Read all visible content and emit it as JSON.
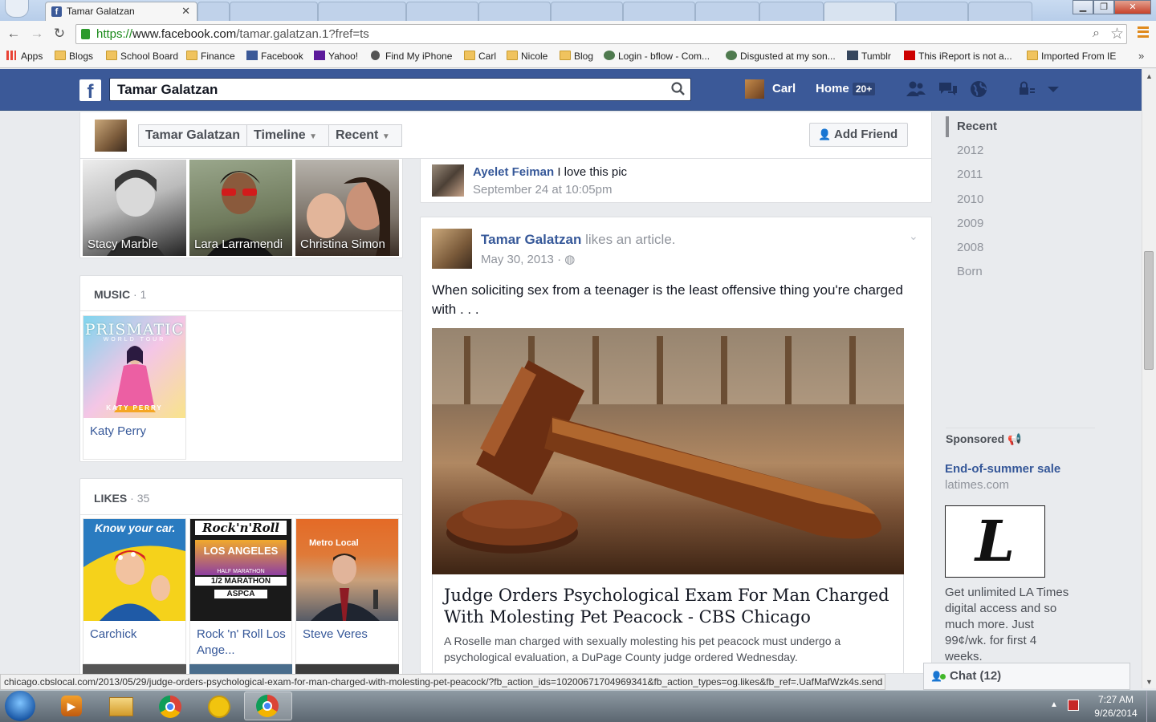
{
  "browser": {
    "active_tab": {
      "title": "Tamar Galatzan",
      "favicon": "f"
    },
    "url": {
      "scheme": "https://",
      "host": "www.facebook.com",
      "path": "/tamar.galatzan.1?fref=ts"
    },
    "bookmarks": [
      {
        "label": "Apps",
        "icon": "apps-grid-icon"
      },
      {
        "label": "Blogs",
        "icon": "folder-icon"
      },
      {
        "label": "School Board",
        "icon": "folder-icon"
      },
      {
        "label": "Finance",
        "icon": "folder-icon"
      },
      {
        "label": "Facebook",
        "icon": "facebook-icon"
      },
      {
        "label": "Yahoo!",
        "icon": "yahoo-icon"
      },
      {
        "label": "Find My iPhone",
        "icon": "apple-icon"
      },
      {
        "label": "Carl",
        "icon": "folder-icon"
      },
      {
        "label": "Nicole",
        "icon": "folder-icon"
      },
      {
        "label": "Blog",
        "icon": "folder-icon"
      },
      {
        "label": "Login - bflow - Com...",
        "icon": "bflow-icon"
      },
      {
        "label": "Disgusted at my son...",
        "icon": "site-icon"
      },
      {
        "label": "Tumblr",
        "icon": "tumblr-icon"
      },
      {
        "label": "This iReport is not a...",
        "icon": "ireport-icon"
      },
      {
        "label": "Imported From IE",
        "icon": "folder-icon"
      }
    ],
    "status_url": "chicago.cbslocal.com/2013/05/29/judge-orders-psychological-exam-for-man-charged-with-molesting-pet-peacock/?fb_action_ids=10200671704969341&fb_action_types=og.likes&fb_ref=.UafMafWzk4s.send"
  },
  "fb": {
    "search_value": "Tamar Galatzan",
    "user_name": "Carl",
    "home_label": "Home",
    "home_badge": "20+"
  },
  "timeline": {
    "breadcrumb": [
      "Tamar Galatzan",
      "Timeline",
      "Recent"
    ],
    "add_friend": "Add Friend",
    "friends": [
      "Stacy Marble",
      "Lara Larramendi",
      "Christina Simon"
    ],
    "music": {
      "title": "MUSIC",
      "count": "1",
      "items": [
        "Katy Perry"
      ],
      "art_text": "PRISMATIC",
      "art_sub": "WORLD TOUR",
      "art_name": "KATY PERRY"
    },
    "likes": {
      "title": "LIKES",
      "count": "35",
      "items": [
        "Carchick",
        "Rock 'n' Roll Los Ange...",
        "Steve Veres"
      ],
      "tile_texts": [
        "Know your car.",
        "Rock'n'Roll",
        "LOS ANGELES",
        "HALF MARATHON",
        "1/2 MARATHON",
        "ASPCA",
        "Metro Local"
      ]
    }
  },
  "feed": {
    "comment": {
      "author": "Ayelet Feiman",
      "text": "I love this pic",
      "time": "September 24 at 10:05pm"
    },
    "post": {
      "author": "Tamar Galatzan",
      "action": "likes an article.",
      "date": "May 30, 2013",
      "text": "When soliciting sex from a teenager is the least offensive thing you're charged with . . .",
      "article_title": "Judge Orders Psychological Exam For Man Charged With Molesting Pet Peacock - CBS Chicago",
      "article_desc": "A Roselle man charged with sexually molesting his pet peacock must undergo a psychological evaluation, a DuPage County judge ordered Wednesday."
    }
  },
  "rail": {
    "years": [
      "Recent",
      "2012",
      "2011",
      "2010",
      "2009",
      "2008",
      "Born"
    ],
    "sponsored": {
      "label": "Sponsored",
      "title": "End-of-summer sale",
      "domain": "latimes.com",
      "logo_letter": "L",
      "body": "Get unlimited LA Times digital access and so much more. Just 99¢/wk. for first 4 weeks."
    },
    "chat": "Chat (12)"
  },
  "taskbar": {
    "time": "7:27 AM",
    "date": "9/26/2014"
  },
  "colors": {
    "fb_blue": "#3b5998",
    "link": "#365899",
    "muted": "#90949c",
    "bg": "#e9ebee"
  }
}
